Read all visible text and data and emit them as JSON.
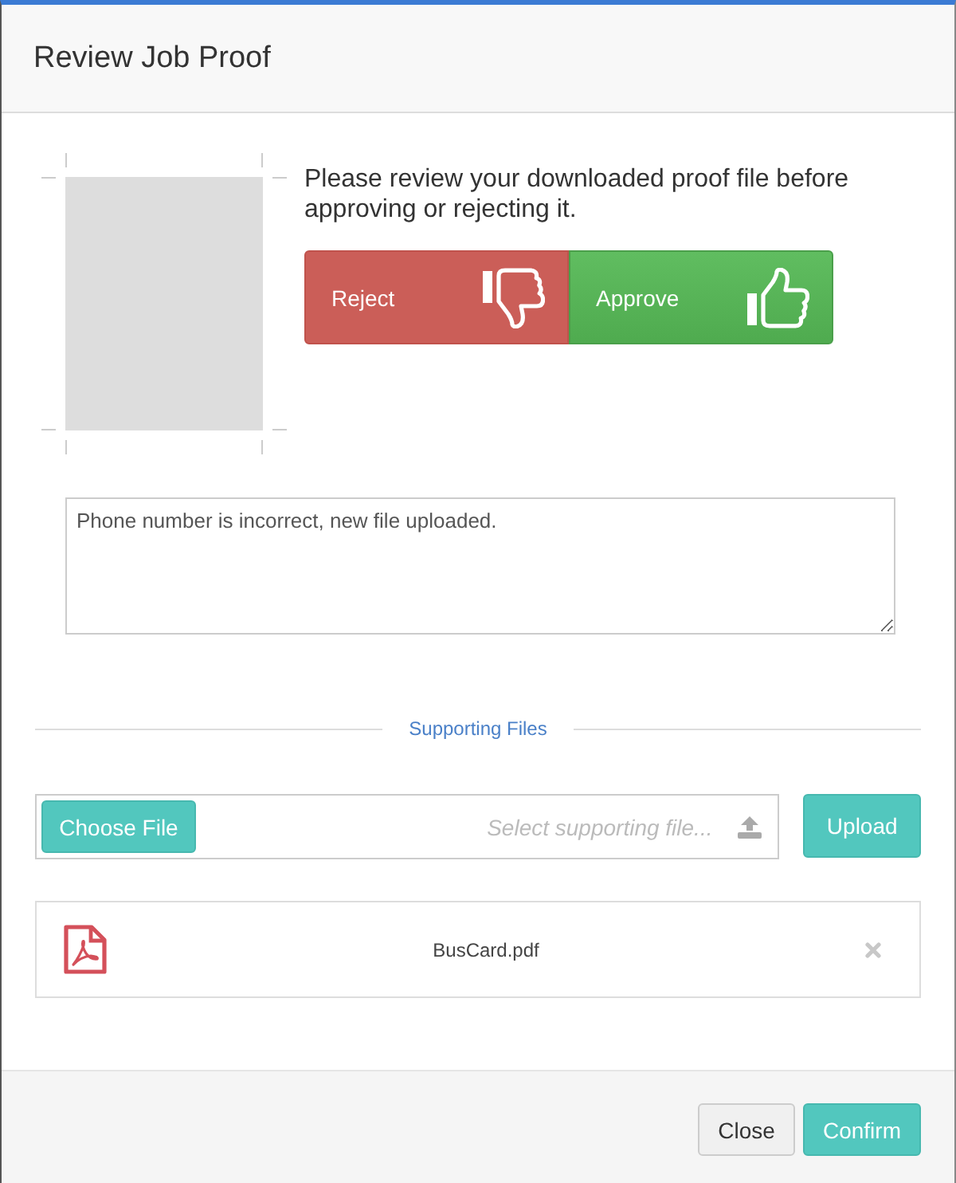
{
  "dialog": {
    "title": "Review Job Proof"
  },
  "proof": {
    "instructions": "Please review your downloaded proof file before approving or rejecting it.",
    "actions": [
      {
        "label": "Reject",
        "kind": "reject"
      },
      {
        "label": "Approve",
        "kind": "approve"
      }
    ]
  },
  "comment": {
    "value": "Phone number is incorrect, new file uploaded."
  },
  "supporting_files": {
    "heading": "Supporting Files",
    "choose_button": "Choose File",
    "placeholder": "Select supporting file...",
    "upload_button": "Upload",
    "files": [
      {
        "name": "BusCard.pdf"
      }
    ]
  },
  "footer": {
    "buttons": [
      {
        "label": "Close",
        "kind": "default"
      },
      {
        "label": "Confirm",
        "kind": "primary"
      }
    ]
  }
}
